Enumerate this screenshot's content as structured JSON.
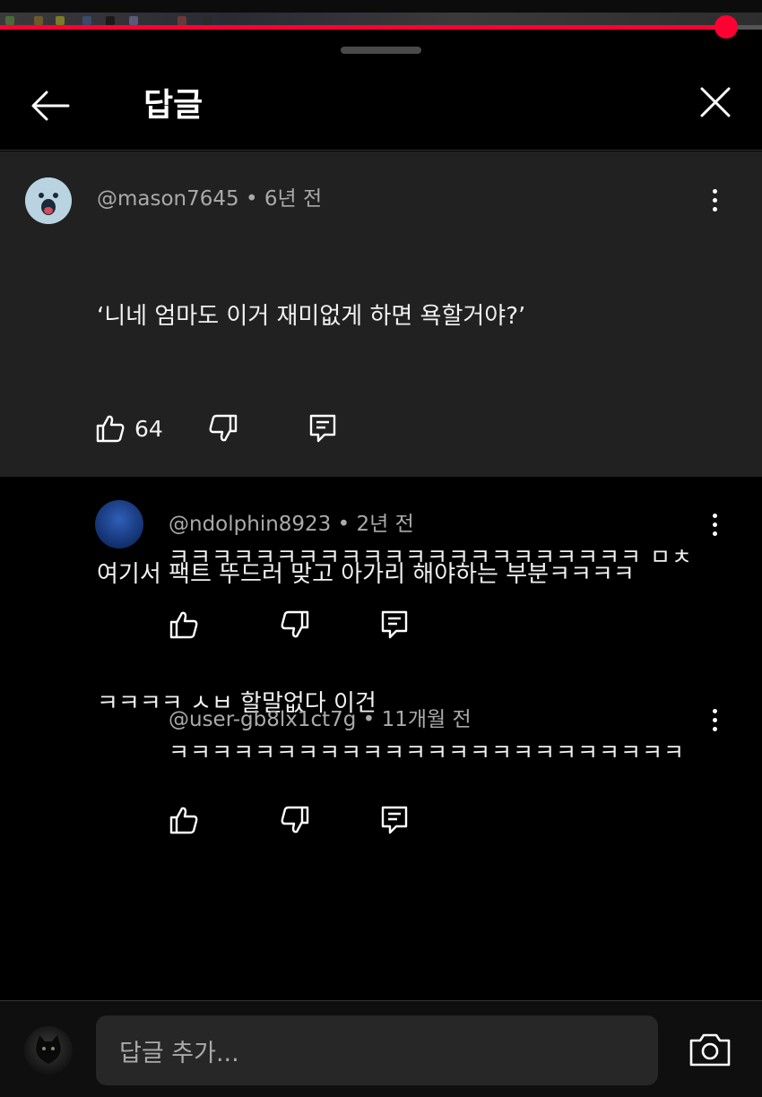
{
  "progress": {
    "fraction": 0.953
  },
  "header": {
    "title": "답글"
  },
  "root_comment": {
    "author": "@mason7645",
    "time": "6년 전",
    "lines": [
      "‘니네 엄마도 이거 재미없게 하면 욕할거야?’",
      "",
      "여기서 팩트 뚜드러 맞고 아가리 해야하는 부분ㅋㅋㅋㅋ",
      "ㅋㅋㅋㅋ ㅅㅂ 할말없다 이건"
    ],
    "likes": "64"
  },
  "replies": [
    {
      "author": "@ndolphin8923",
      "time": "2년 전",
      "text": "ㅋㅋㅋㅋㅋㅋㅋㅋㅋㅋㅋㅋㅋㅋㅋㅋㅋㅋㅋㅋㅋㅋ ㅁㅊ"
    },
    {
      "author": "@user-gb8lx1ct7g",
      "time": "11개월 전",
      "text": "ㅋㅋㅋㅋㅋㅋㅋㅋㅋㅋㅋㅋㅋㅋㅋㅋㅋㅋㅋㅋㅋㅋㅋㅋ"
    }
  ],
  "separator": "•",
  "footer": {
    "placeholder": "답글 추가..."
  },
  "icons": {
    "back": "arrow-left-icon",
    "close": "close-icon",
    "more": "more-vert-icon",
    "like": "thumbs-up-icon",
    "dislike": "thumbs-down-icon",
    "reply": "reply-icon",
    "camera": "camera-icon"
  },
  "colors": {
    "accent": "#ff0033",
    "root_bg": "#212121",
    "meta": "#aaaaaa",
    "input_bg": "#272727"
  }
}
